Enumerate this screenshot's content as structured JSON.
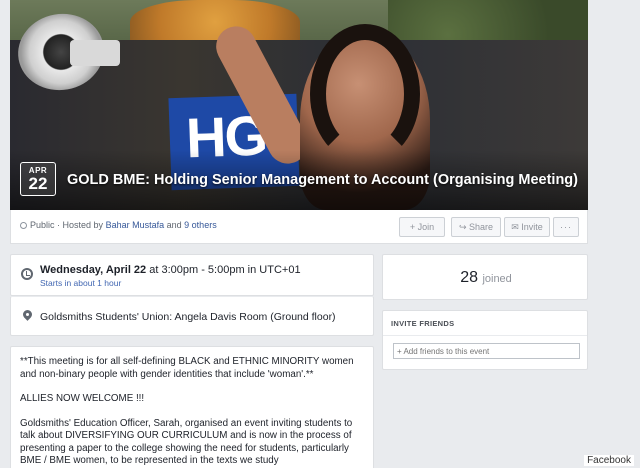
{
  "event": {
    "date_month": "APR",
    "date_day": "22",
    "title": "GOLD BME: Holding Senior Management to Account (Organising Meeting)"
  },
  "info_bar": {
    "privacy": "Public",
    "hosted_prefix": "· Hosted by",
    "host": "Bahar Mustafa",
    "and": "and",
    "others": "9 others",
    "join_label": "+ Join",
    "share_label": "Share",
    "invite_label": "Invite",
    "more_label": "···"
  },
  "when": {
    "date_bold": "Wednesday, April 22",
    "time": "at 3:00pm - 5:00pm in UTC+01",
    "sub": "Starts in about 1 hour"
  },
  "where": {
    "place": "Goldsmiths Students' Union: Angela Davis Room (Ground floor)"
  },
  "description": {
    "p1": "**This meeting is for all self-defining BLACK and ETHNIC MINORITY women and non-binary people with gender identities that include 'woman'.**",
    "p2": "ALLIES NOW WELCOME !!!",
    "p3": "Goldsmiths' Education Officer, Sarah, organised an event inviting students to talk about DIVERSIFYING OUR CURRICULUM and is now in the process of presenting a paper to the college showing the need for students, particularly BME / BME women, to be represented in the texts we study"
  },
  "joined": {
    "count": "28",
    "label": "joined"
  },
  "invite": {
    "heading": "INVITE FRIENDS",
    "placeholder": "+ Add friends to this event"
  },
  "watermark": "Facebook"
}
